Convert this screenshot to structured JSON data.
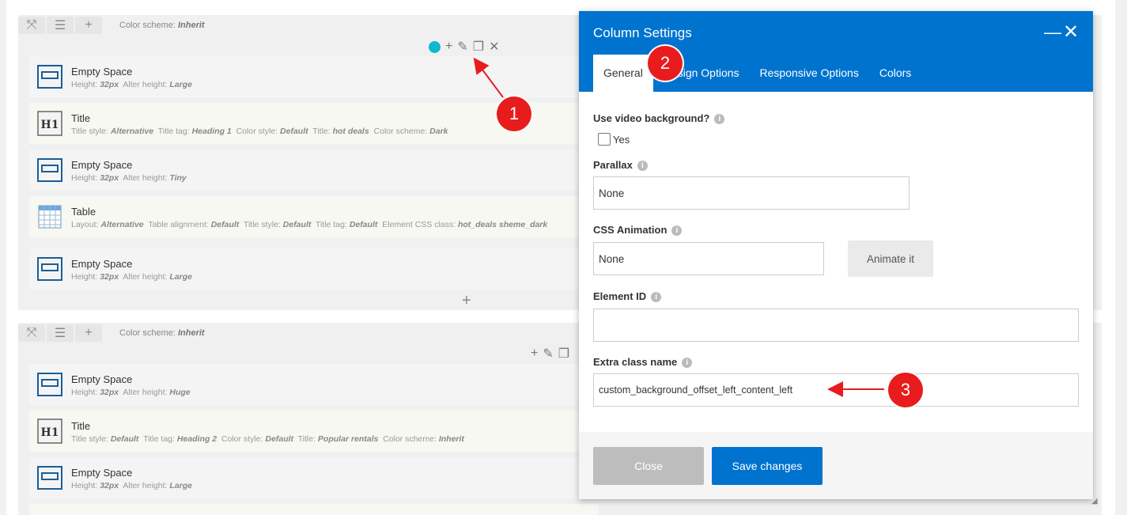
{
  "rows": [
    {
      "color_scheme_label": "Color scheme",
      "color_scheme_value": "Inherit",
      "elements": [
        {
          "name": "Empty Space",
          "params": [
            [
              "Height",
              "32px"
            ],
            [
              "Alter height",
              "Large"
            ]
          ]
        },
        {
          "name": "Title",
          "params": [
            [
              "Title style",
              "Alternative"
            ],
            [
              "Title tag",
              "Heading 1"
            ],
            [
              "Color style",
              "Default"
            ],
            [
              "Title",
              "hot deals"
            ],
            [
              "Color scheme",
              "Dark"
            ]
          ]
        },
        {
          "name": "Empty Space",
          "params": [
            [
              "Height",
              "32px"
            ],
            [
              "Alter height",
              "Tiny"
            ]
          ]
        },
        {
          "name": "Table",
          "params": [
            [
              "Layout",
              "Alternative"
            ],
            [
              "Table alignment",
              "Default"
            ],
            [
              "Title style",
              "Default"
            ],
            [
              "Title tag",
              "Default"
            ],
            [
              "Element CSS class",
              "hot_deals sheme_dark"
            ]
          ]
        },
        {
          "name": "Empty Space",
          "params": [
            [
              "Height",
              "32px"
            ],
            [
              "Alter height",
              "Large"
            ]
          ]
        }
      ]
    },
    {
      "color_scheme_label": "Color scheme",
      "color_scheme_value": "Inherit",
      "elements": [
        {
          "name": "Empty Space",
          "params": [
            [
              "Height",
              "32px"
            ],
            [
              "Alter height",
              "Huge"
            ]
          ]
        },
        {
          "name": "Title",
          "params": [
            [
              "Title style",
              "Default"
            ],
            [
              "Title tag",
              "Heading 2"
            ],
            [
              "Color style",
              "Default"
            ],
            [
              "Title",
              "Popular rentals"
            ],
            [
              "Color scheme",
              "Inherit"
            ]
          ]
        },
        {
          "name": "Empty Space",
          "params": [
            [
              "Height",
              "32px"
            ],
            [
              "Alter height",
              "Large"
            ]
          ]
        }
      ]
    }
  ],
  "modal": {
    "title": "Column Settings",
    "tabs": [
      "General",
      "Design Options",
      "Responsive Options",
      "Colors"
    ],
    "fields": {
      "video_bg_label": "Use video background?",
      "video_bg_option": "Yes",
      "parallax_label": "Parallax",
      "parallax_value": "None",
      "css_animation_label": "CSS Animation",
      "css_animation_value": "None",
      "animate_button": "Animate it",
      "element_id_label": "Element ID",
      "element_id_value": "",
      "extra_class_label": "Extra class name",
      "extra_class_value": "custom_background_offset_left_content_left"
    },
    "close_button": "Close",
    "save_button": "Save changes"
  },
  "annotations": [
    "1",
    "2",
    "3"
  ],
  "colors": {
    "accent": "#0073cf",
    "annotation": "#e81c1c",
    "dot": "#10b8d1"
  }
}
